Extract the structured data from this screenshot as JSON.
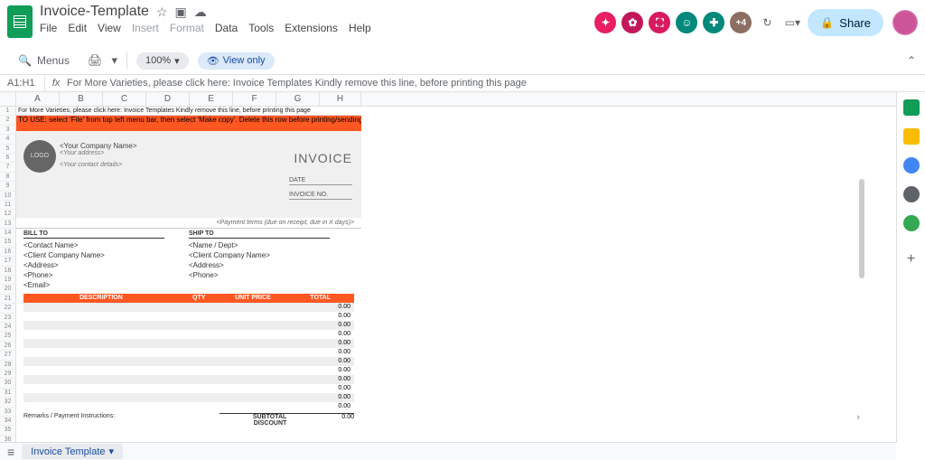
{
  "app": {
    "title": "Invoice-Template"
  },
  "menubar": {
    "file": "File",
    "edit": "Edit",
    "view": "View",
    "insert": "Insert",
    "format": "Format",
    "data": "Data",
    "tools": "Tools",
    "extensions": "Extensions",
    "help": "Help"
  },
  "toolbar": {
    "menus": "Menus",
    "zoom": "100%",
    "viewonly": "View only",
    "printIcon": "🖨",
    "caret": "▾",
    "search": "🔍"
  },
  "share": {
    "label": "Share"
  },
  "formula": {
    "cellref": "A1:H1",
    "text": "For More Varieties, please click here: Invoice Templates Kindly remove this line, before printing this page"
  },
  "columns": [
    "A",
    "B",
    "C",
    "D",
    "E",
    "F",
    "G",
    "H"
  ],
  "firstRow": "For More Varieties, please click here: Invoice Templates Kindly remove this line, before printing this page",
  "orangeRow": "TO USE: select 'File' from top left menu bar, then select 'Make copy'. Delete this row before printing/sending your",
  "company": {
    "name": "<Your Company Name>",
    "address": "<Your address>",
    "contact": "<Your contact details>",
    "logo": "LOGO"
  },
  "invoice": {
    "title": "INVOICE",
    "date": "DATE",
    "invno": "INVOICE NO."
  },
  "paymentTerms": "<Payment terms (due on receipt, due in X days)>",
  "bill": {
    "head": "BILL TO",
    "contact": "<Contact Name>",
    "company": "<Client Company Name>",
    "address": "<Address>",
    "phone": "<Phone>",
    "email": "<Email>"
  },
  "ship": {
    "head": "SHIP TO",
    "name": "<Name / Dept>",
    "company": "<Client Company Name>",
    "address": "<Address>",
    "phone": "<Phone>"
  },
  "items": {
    "descHead": "DESCRIPTION",
    "qtyHead": "QTY",
    "unitHead": "UNIT PRICE",
    "totalHead": "TOTAL",
    "zero": "0.00"
  },
  "footer": {
    "remarks": "Remarks / Payment Instructions:",
    "subtotal": "SUBTOTAL",
    "discount": "DISCOUNT",
    "subval": "0.00"
  },
  "tab": {
    "name": "Invoice Template"
  }
}
